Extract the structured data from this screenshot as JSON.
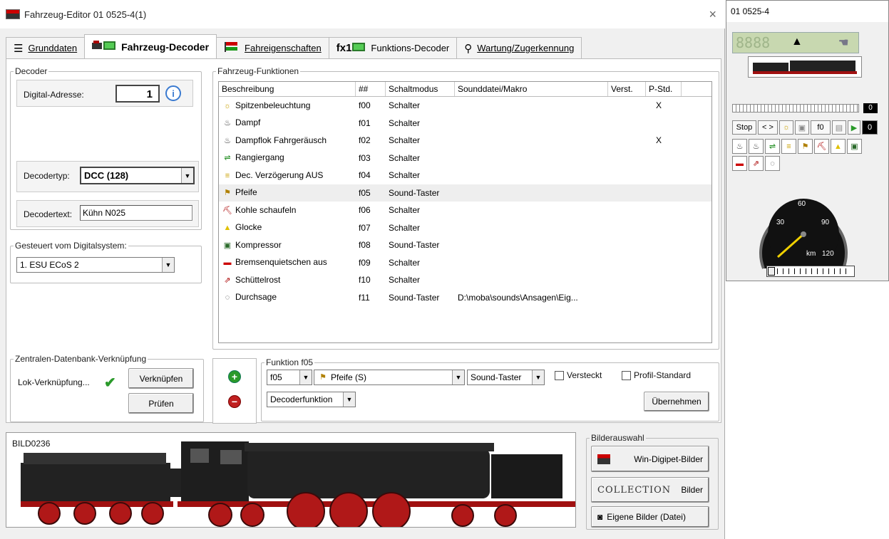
{
  "window": {
    "title": "Fahrzeug-Editor 01 0525-4(1)",
    "close": "×"
  },
  "tabs": [
    {
      "label": "Grunddaten",
      "icon": "list-icon"
    },
    {
      "label": "Fahrzeug-Decoder",
      "icon": "decoder-icon"
    },
    {
      "label": "Fahreigenschaften",
      "icon": "flag-icon"
    },
    {
      "label": "Funktions-Decoder",
      "prefix": "fx1",
      "icon": "function-decoder-icon"
    },
    {
      "label": "Wartung/Zugerkennung",
      "icon": "wrench-icon"
    }
  ],
  "decoder": {
    "legend": "Decoder",
    "address_label": "Digital-Adresse:",
    "address_value": "1",
    "type_label": "Decodertyp:",
    "type_value": "DCC (128)",
    "text_label": "Decodertext:",
    "text_value": "Kühn N025"
  },
  "digital_system": {
    "legend": "Gesteuert vom Digitalsystem:",
    "value": "1. ESU ECoS 2"
  },
  "zentrale": {
    "legend": "Zentralen-Datenbank-Verknüpfung",
    "label": "Lok-Verknüpfung...",
    "link_button": "Verknüpfen",
    "check_button": "Prüfen"
  },
  "functions": {
    "legend": "Fahrzeug-Funktionen",
    "columns": [
      "Beschreibung",
      "##",
      "Schaltmodus",
      "Sounddatei/Makro",
      "Verst.",
      "P-Std."
    ],
    "rows": [
      {
        "desc": "Spitzenbeleuchtung",
        "num": "f00",
        "mode": "Schalter",
        "file": "",
        "verst": "",
        "pstd": "X",
        "icon": "headlight-icon",
        "glyph": "☼",
        "color": "#c9a000"
      },
      {
        "desc": "Dampf",
        "num": "f01",
        "mode": "Schalter",
        "file": "",
        "verst": "",
        "pstd": "",
        "icon": "steam-icon",
        "glyph": "♨",
        "color": "#333"
      },
      {
        "desc": "Dampflok Fahrgeräusch",
        "num": "f02",
        "mode": "Schalter",
        "file": "",
        "verst": "",
        "pstd": "X",
        "icon": "steam-sound-icon",
        "glyph": "♨",
        "color": "#333"
      },
      {
        "desc": "Rangiergang",
        "num": "f03",
        "mode": "Schalter",
        "file": "",
        "verst": "",
        "pstd": "",
        "icon": "shunting-icon",
        "glyph": "⇌",
        "color": "#1a8a1a"
      },
      {
        "desc": "Dec. Verzögerung AUS",
        "num": "f04",
        "mode": "Schalter",
        "file": "",
        "verst": "",
        "pstd": "",
        "icon": "delay-icon",
        "glyph": "≡",
        "color": "#c9a000"
      },
      {
        "desc": "Pfeife",
        "num": "f05",
        "mode": "Sound-Taster",
        "file": "",
        "verst": "",
        "pstd": "",
        "icon": "whistle-icon",
        "glyph": "⚑",
        "color": "#b08000"
      },
      {
        "desc": "Kohle schaufeln",
        "num": "f06",
        "mode": "Schalter",
        "file": "",
        "verst": "",
        "pstd": "",
        "icon": "shovel-icon",
        "glyph": "⛏",
        "color": "#a00"
      },
      {
        "desc": "Glocke",
        "num": "f07",
        "mode": "Schalter",
        "file": "",
        "verst": "",
        "pstd": "",
        "icon": "bell-icon",
        "glyph": "▲",
        "color": "#e0c000"
      },
      {
        "desc": "Kompressor",
        "num": "f08",
        "mode": "Sound-Taster",
        "file": "",
        "verst": "",
        "pstd": "",
        "icon": "compressor-icon",
        "glyph": "▣",
        "color": "#2a6a2a"
      },
      {
        "desc": "Bremsenquietschen aus",
        "num": "f09",
        "mode": "Schalter",
        "file": "",
        "verst": "",
        "pstd": "",
        "icon": "brake-icon",
        "glyph": "▬",
        "color": "#c00"
      },
      {
        "desc": "Schüttelrost",
        "num": "f10",
        "mode": "Schalter",
        "file": "",
        "verst": "",
        "pstd": "",
        "icon": "grate-icon",
        "glyph": "⇗",
        "color": "#a00"
      },
      {
        "desc": "Durchsage",
        "num": "f11",
        "mode": "Sound-Taster",
        "file": "D:\\moba\\sounds\\Ansagen\\Eig...",
        "verst": "",
        "pstd": "",
        "icon": "announcement-icon",
        "glyph": "◌",
        "color": "#333"
      }
    ]
  },
  "function_editor": {
    "legend": "Funktion f05",
    "num_value": "f05",
    "desc_value": "Pfeife (S)",
    "mode_value": "Sound-Taster",
    "hidden_label": "Versteckt",
    "profile_label": "Profil-Standard",
    "type_value": "Decoderfunktion",
    "apply_button": "Übernehmen"
  },
  "image": {
    "caption": "BILD0236"
  },
  "bildauswahl": {
    "legend": "Bilderauswahl",
    "btn1": "Win-Digipet-Bilder",
    "btn2_logo": "COLLECTION",
    "btn2": "Bilder",
    "btn3": "Eigene Bilder (Datei)"
  },
  "side": {
    "title": "01 0525-4",
    "lcd": "8888",
    "stop": "Stop",
    "arrows": "< >",
    "f_label": "f0",
    "speed_step": "0",
    "counter": "0",
    "speedo_unit": "km",
    "ticks": [
      "30",
      "60",
      "90",
      "120"
    ]
  }
}
